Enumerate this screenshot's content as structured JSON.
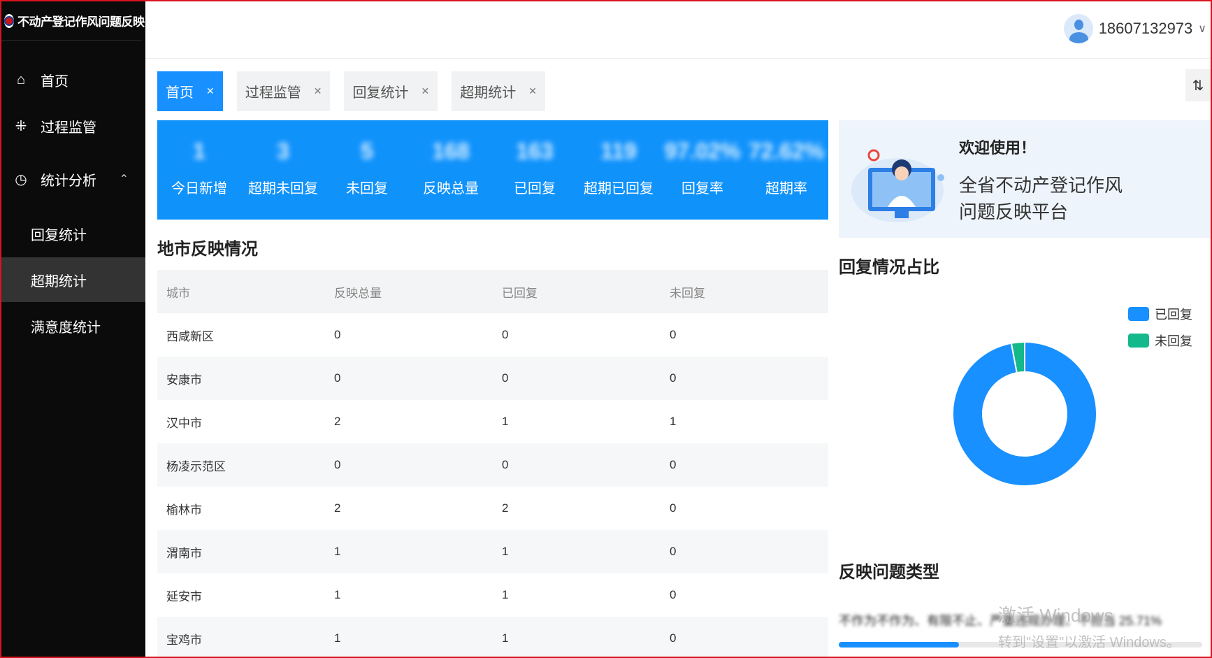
{
  "app": {
    "title": "不动产登记作风问题反映"
  },
  "sidebar": {
    "items": [
      {
        "label": "首页",
        "icon": "home-icon"
      },
      {
        "label": "过程监管",
        "icon": "process-icon"
      },
      {
        "label": "统计分析",
        "icon": "clock-icon",
        "expanded": true
      },
      {
        "label": "回复统计"
      },
      {
        "label": "超期统计",
        "active": true
      },
      {
        "label": "满意度统计"
      }
    ]
  },
  "header": {
    "user": "18607132973"
  },
  "tabs": [
    {
      "label": "首页",
      "active": true
    },
    {
      "label": "过程监管"
    },
    {
      "label": "回复统计"
    },
    {
      "label": "超期统计"
    }
  ],
  "stats": [
    {
      "value": "1",
      "label": "今日新增"
    },
    {
      "value": "3",
      "label": "超期未回复"
    },
    {
      "value": "5",
      "label": "未回复"
    },
    {
      "value": "168",
      "label": "反映总量"
    },
    {
      "value": "163",
      "label": "已回复"
    },
    {
      "value": "119",
      "label": "超期已回复"
    },
    {
      "value": "97.02%",
      "label": "回复率"
    },
    {
      "value": "72.62%",
      "label": "超期率"
    }
  ],
  "city_section": {
    "title": "地市反映情况",
    "columns": [
      "城市",
      "反映总量",
      "已回复",
      "未回复"
    ],
    "rows": [
      [
        "西咸新区",
        "0",
        "0",
        "0"
      ],
      [
        "安康市",
        "0",
        "0",
        "0"
      ],
      [
        "汉中市",
        "2",
        "1",
        "1"
      ],
      [
        "杨凌示范区",
        "0",
        "0",
        "0"
      ],
      [
        "榆林市",
        "2",
        "2",
        "0"
      ],
      [
        "渭南市",
        "1",
        "1",
        "0"
      ],
      [
        "延安市",
        "1",
        "1",
        "0"
      ],
      [
        "宝鸡市",
        "1",
        "1",
        "0"
      ]
    ]
  },
  "welcome": {
    "greeting": "欢迎使用！",
    "platform": "全省不动产登记作风问题反映平台"
  },
  "reply_chart": {
    "title": "回复情况占比",
    "legend": [
      {
        "name": "已回复",
        "color": "#1890ff"
      },
      {
        "name": "未回复",
        "color": "#13b98a"
      }
    ]
  },
  "chart_data": {
    "type": "pie",
    "categories": [
      "已回复",
      "未回复"
    ],
    "values": [
      163,
      5
    ]
  },
  "issue_types": {
    "title": "反映问题类型",
    "blurred_line": "不作为不作为、有限不止、严重违规办理、不担当 25.71%",
    "progress": 0.33
  },
  "watermark": {
    "line1": "激活 Windows",
    "line2": "转到\"设置\"以激活 Windows。"
  }
}
